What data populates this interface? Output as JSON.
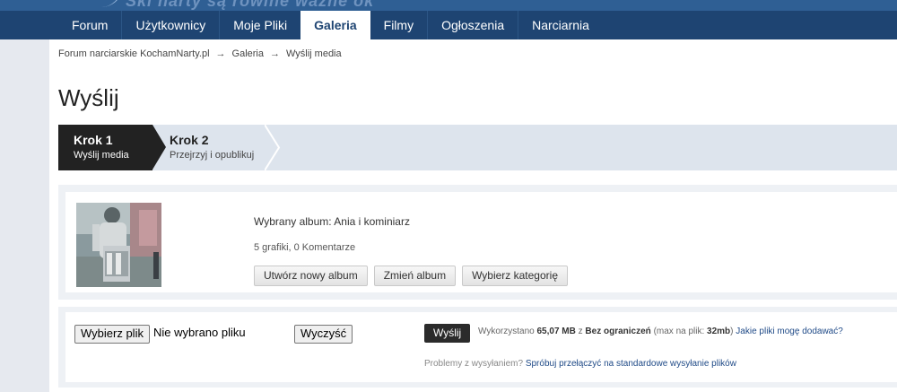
{
  "header": {
    "slogan": "Ski narty są rówine ważne ok"
  },
  "nav": {
    "tabs": [
      {
        "label": "Forum",
        "active": false
      },
      {
        "label": "Użytkownicy",
        "active": false
      },
      {
        "label": "Moje Pliki",
        "active": false
      },
      {
        "label": "Galeria",
        "active": true
      },
      {
        "label": "Filmy",
        "active": false
      },
      {
        "label": "Ogłoszenia",
        "active": false
      },
      {
        "label": "Narciarnia",
        "active": false
      }
    ]
  },
  "breadcrumb": {
    "items": [
      "Forum narciarskie KochamNarty.pl",
      "Galeria",
      "Wyślij media"
    ],
    "separator": "→"
  },
  "page": {
    "title": "Wyślij"
  },
  "steps": [
    {
      "title": "Krok 1",
      "subtitle": "Wyślij media",
      "active": true
    },
    {
      "title": "Krok 2",
      "subtitle": "Przejrzyj i opublikuj",
      "active": false
    }
  ],
  "album": {
    "selected_label": "Wybrany album: Ania i kominiarz",
    "meta": "5 grafiki, 0 Komentarze",
    "buttons": {
      "create": "Utwórz nowy album",
      "change": "Zmień album",
      "category": "Wybierz kategorię"
    }
  },
  "upload": {
    "choose_file": "Wybierz plik",
    "no_file": "Nie wybrano pliku",
    "clear": "Wyczyść",
    "send": "Wyślij",
    "usage": {
      "prefix": "Wykorzystano",
      "used": "65,07 MB",
      "of": "z",
      "limit": "Bez ograniczeń",
      "max_prefix": "(max na plik:",
      "max_value": "32mb",
      "max_suffix": ")",
      "link": "Jakie pliki mogę dodawać?"
    },
    "problems": {
      "text": "Problemy z wysyłaniem?",
      "link": "Spróbuj przełączyć na standardowe wysyłanie plików"
    }
  },
  "colors": {
    "nav_bg": "#1e4472",
    "header_bg": "#2f5f94",
    "active_step_bg": "#222222",
    "link": "#1f4a87"
  }
}
